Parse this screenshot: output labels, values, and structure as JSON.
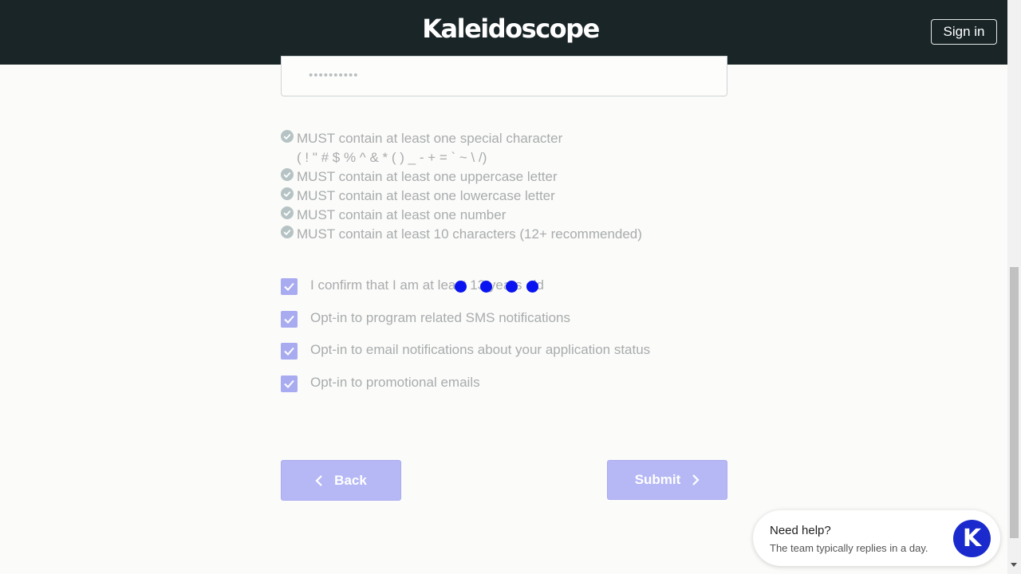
{
  "header": {
    "logo_text": "Kaleidoscope",
    "signin_label": "Sign in"
  },
  "password_field": {
    "value_masked": "••••••••••"
  },
  "password_rules": [
    "MUST contain at least one special character",
    "( ! \" # $ % ^ & * ( ) _ - + = ` ~ \\ /)",
    "MUST contain at least one uppercase letter",
    "MUST contain at least one lowercase letter",
    "MUST contain at least one number",
    "MUST contain at least 10 characters (12+ recommended)"
  ],
  "options": [
    {
      "label": "I confirm that I am at least 13 years old",
      "checked": true
    },
    {
      "label": "Opt-in to program related SMS notifications",
      "checked": true
    },
    {
      "label": "Opt-in to email notifications about your application status",
      "checked": true
    },
    {
      "label": "Opt-in to promotional emails",
      "checked": true
    }
  ],
  "buttons": {
    "back_label": "Back",
    "submit_label": "Submit"
  },
  "help_widget": {
    "title": "Need help?",
    "subtitle": "The team typically replies in a day.",
    "avatar_letter": "K"
  },
  "colors": {
    "header_bg": "#1a2528",
    "accent": "#a9abf1",
    "loading_dots": "#0a14f0"
  }
}
